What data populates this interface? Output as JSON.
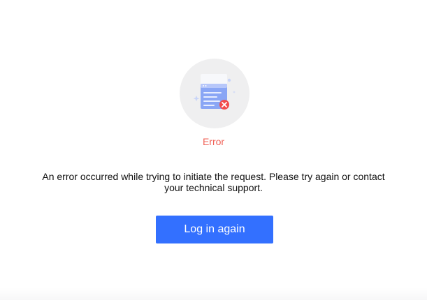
{
  "error": {
    "illustration_icon": "document-error-icon",
    "title": "Error",
    "message_line1": "An error occurred while trying to initiate the request. Please try again or contact",
    "message_line2": "your technical support.",
    "button_label": "Log in again"
  },
  "colors": {
    "title": "#f0645a",
    "button": "#3370ff",
    "error_badge": "#f24c4c"
  }
}
